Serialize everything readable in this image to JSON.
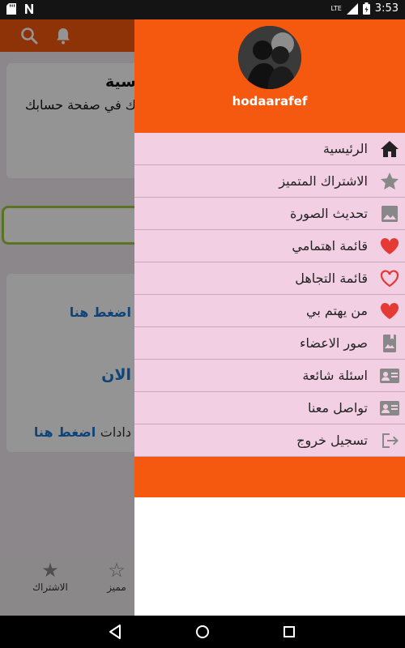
{
  "status_bar": {
    "time": "3:53",
    "network": "LTE",
    "icons": [
      "sd-card-icon",
      "notification-icon",
      "signal-icon",
      "battery-icon"
    ]
  },
  "background": {
    "header_icons": [
      "search-icon",
      "bell-icon"
    ],
    "card1_title": "سية",
    "card1_subtitle": "ك في صفحة حسابك",
    "card2_link1": "اضغط هنا",
    "card2_link2": "الان",
    "card2_text3_plain": "دادات",
    "card2_text3_link": "اضغط هنا",
    "bottom_nav": [
      {
        "label": "الاشتراك",
        "icon": "star-icon"
      },
      {
        "label": "مميز",
        "icon": "star-outline-icon"
      }
    ]
  },
  "drawer": {
    "username": "hodaarafef",
    "menu": [
      {
        "label": "الرئيسية",
        "icon": "home-icon"
      },
      {
        "label": "الاشتراك المتميز",
        "icon": "star-icon"
      },
      {
        "label": "تحديث الصورة",
        "icon": "image-icon"
      },
      {
        "label": "قائمة اهتمامي",
        "icon": "heart-filled-icon"
      },
      {
        "label": "قائمة التجاهل",
        "icon": "heart-outline-icon"
      },
      {
        "label": "من يهتم بي",
        "icon": "heart-filled-icon"
      },
      {
        "label": "صور الاعضاء",
        "icon": "photo-album-icon"
      },
      {
        "label": "اسئلة شائعة",
        "icon": "contact-card-icon"
      },
      {
        "label": "تواصل معنا",
        "icon": "contact-card-icon"
      },
      {
        "label": "تسجيل خروج",
        "icon": "logout-icon"
      }
    ]
  },
  "colors": {
    "accent": "#f4590f",
    "menu_bg": "#f2cfe3",
    "heart": "#e53935",
    "link": "#1976d2"
  }
}
